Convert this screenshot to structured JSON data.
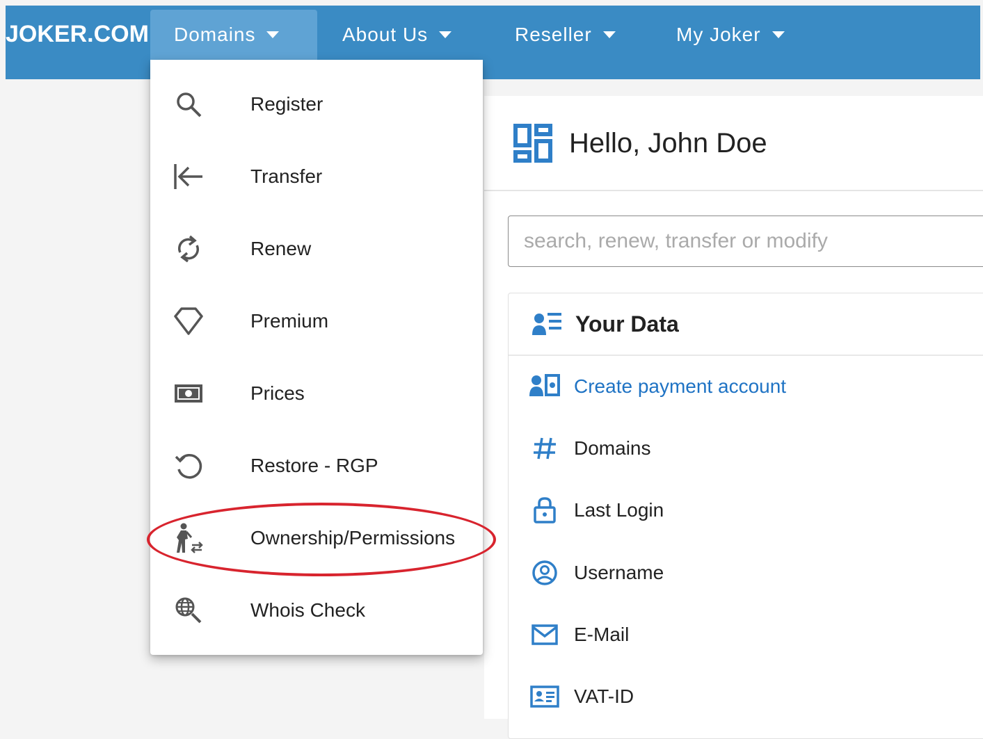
{
  "topbar": {
    "logo": "JOKER.COM",
    "nav": [
      {
        "label": "Domains"
      },
      {
        "label": "About Us"
      },
      {
        "label": "Reseller"
      },
      {
        "label": "My Joker"
      }
    ]
  },
  "dropdown": {
    "items": [
      {
        "label": "Register",
        "icon": "search-icon"
      },
      {
        "label": "Transfer",
        "icon": "transfer-icon"
      },
      {
        "label": "Renew",
        "icon": "renew-icon"
      },
      {
        "label": "Premium",
        "icon": "diamond-icon"
      },
      {
        "label": "Prices",
        "icon": "money-icon"
      },
      {
        "label": "Restore - RGP",
        "icon": "restore-icon"
      },
      {
        "label": "Ownership/Permissions",
        "icon": "ownership-icon"
      },
      {
        "label": "Whois Check",
        "icon": "globe-search-icon"
      }
    ]
  },
  "main": {
    "greeting": "Hello, John Doe",
    "search_placeholder": "search, renew, transfer or modify",
    "your_data": {
      "title": "Your Data",
      "rows": [
        {
          "label": "Create payment account",
          "icon": "payment-account-icon"
        },
        {
          "label": "Domains",
          "icon": "hash-icon"
        },
        {
          "label": "Last Login",
          "icon": "lock-icon"
        },
        {
          "label": "Username",
          "icon": "user-circle-icon"
        },
        {
          "label": "E-Mail",
          "icon": "mail-icon"
        },
        {
          "label": "VAT-ID",
          "icon": "id-card-icon"
        }
      ]
    }
  },
  "colors": {
    "topbar": "#3a8bc4",
    "link": "#1f73c4",
    "icon_blue": "#2f7fc8",
    "highlight": "#d8242e"
  }
}
